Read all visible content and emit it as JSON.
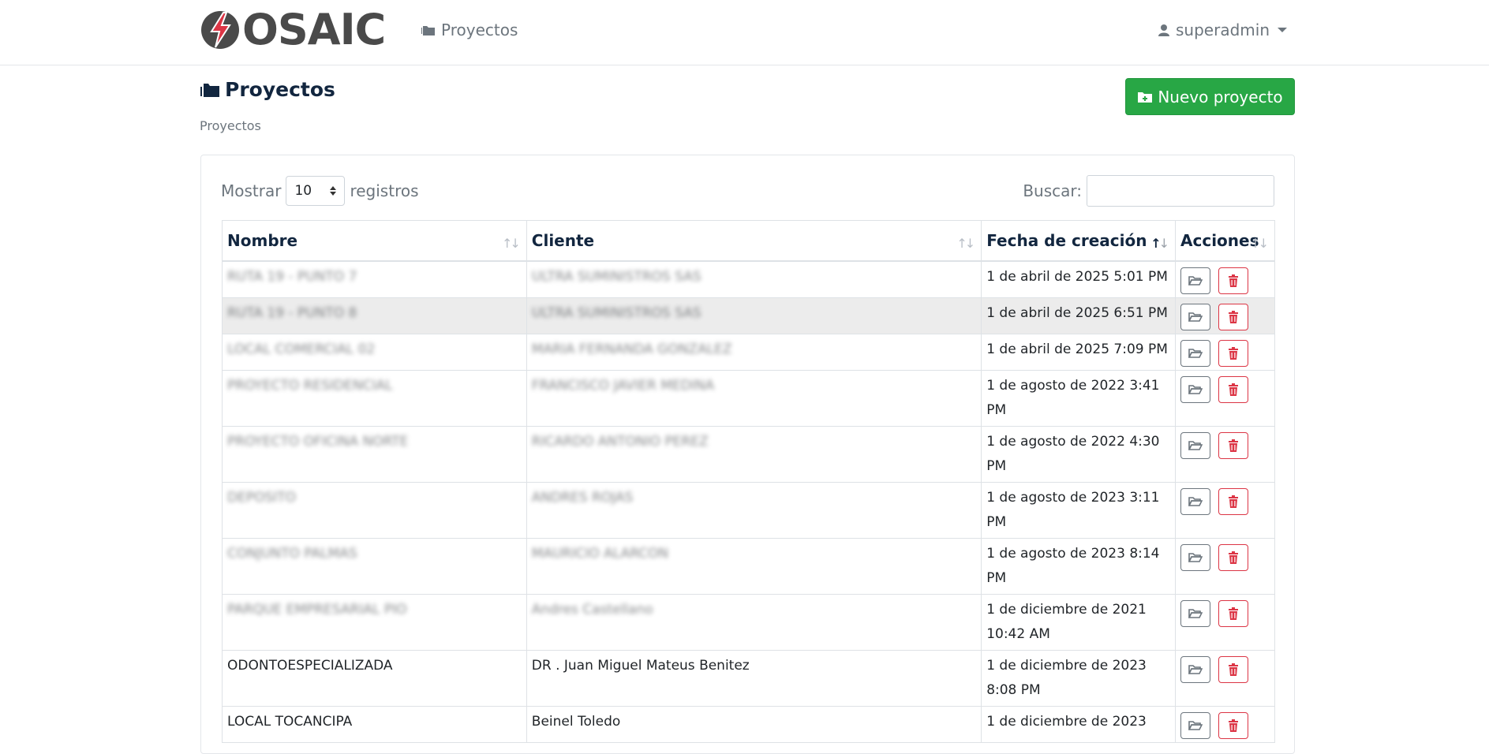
{
  "brand": {
    "name": "OSAIC",
    "accent": "#dc3545"
  },
  "nav": {
    "projects_label": "Proyectos",
    "user_label": "superadmin"
  },
  "header": {
    "title": "Proyectos",
    "breadcrumb": "Proyectos",
    "new_button": "Nuevo proyecto"
  },
  "table_controls": {
    "show_label": "Mostrar",
    "page_size": "10",
    "records_label": "registros",
    "search_label": "Buscar:"
  },
  "columns": {
    "name": "Nombre",
    "client": "Cliente",
    "created": "Fecha de creación",
    "actions": "Acciones"
  },
  "rows": [
    {
      "name": "RUTA 19 - PUNTO 7",
      "client": "ULTRA SUMINISTROS SAS",
      "created": "1 de abril de 2025 5:01 PM"
    },
    {
      "name": "RUTA 19 - PUNTO 8",
      "client": "ULTRA SUMINISTROS SAS",
      "created": "1 de abril de 2025 6:51 PM"
    },
    {
      "name": "LOCAL COMERCIAL 02",
      "client": "MARIA FERNANDA GONZALEZ",
      "created": "1 de abril de 2025 7:09 PM"
    },
    {
      "name": "PROYECTO RESIDENCIAL",
      "client": "FRANCISCO JAVIER MEDINA",
      "created": "1 de agosto de 2022 3:41 PM"
    },
    {
      "name": "PROYECTO OFICINA NORTE",
      "client": "RICARDO ANTONIO PEREZ",
      "created": "1 de agosto de 2022 4:30 PM"
    },
    {
      "name": "DEPOSITO",
      "client": "ANDRES ROJAS",
      "created": "1 de agosto de 2023 3:11 PM"
    },
    {
      "name": "CONJUNTO PALMAS",
      "client": "MAURICIO ALARCON",
      "created": "1 de agosto de 2023 8:14 PM"
    },
    {
      "name": "PARQUE EMPRESARIAL PIO",
      "client": "Andres Castellano",
      "created": "1 de diciembre de 2021 10:42 AM"
    },
    {
      "name": "ODONTOESPECIALIZADA",
      "client": "DR . Juan Miguel Mateus Benitez",
      "created": "1 de diciembre de 2023 8:08 PM"
    },
    {
      "name": "LOCAL TOCANCIPA",
      "client": "Beinel Toledo",
      "created": "1 de diciembre de 2023"
    }
  ]
}
